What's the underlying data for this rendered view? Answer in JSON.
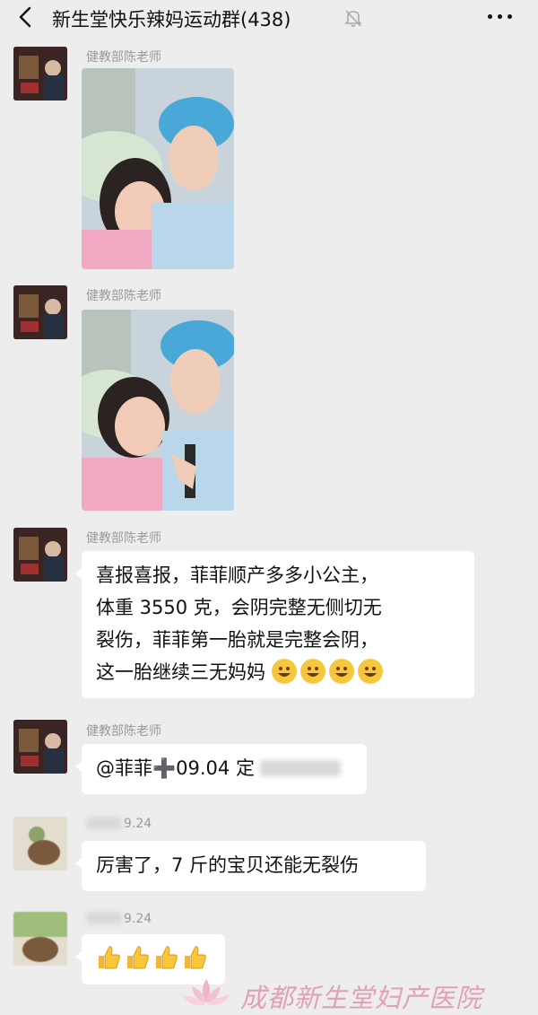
{
  "header": {
    "title": "新生堂快乐辣妈运动群(438)",
    "back_icon": "chevron-left-icon",
    "mute_icon": "bell-off-icon",
    "more_icon": "more-dots-icon"
  },
  "messages": [
    {
      "sender": "健教部陈老师",
      "type": "image"
    },
    {
      "sender": "健教部陈老师",
      "type": "image"
    },
    {
      "sender": "健教部陈老师",
      "type": "text",
      "lines": [
        "喜报喜报，菲菲顺产多多小公主，",
        "体重 3550 克，会阴完整无侧切无",
        "裂伤，菲菲第一胎就是完整会阴，",
        "这一胎继续三无妈妈"
      ],
      "emoji": "grinning-face-emoji",
      "emoji_count": 4
    },
    {
      "sender": "健教部陈老师",
      "type": "text",
      "lines": [
        "@菲菲➕09.04 定"
      ]
    },
    {
      "sender": "9.24",
      "type": "text",
      "lines": [
        "厉害了，7 斤的宝贝还能无裂伤"
      ]
    },
    {
      "sender": "9.24",
      "type": "text",
      "lines": [
        ""
      ],
      "emoji": "thumbs-up-emoji",
      "emoji_count": 4
    }
  ],
  "watermark": {
    "text": "成都新生堂妇产医院"
  },
  "colors": {
    "background": "#ededed",
    "bubble": "#ffffff",
    "sender_name": "#9a9a9a",
    "watermark": "#e1a0b8"
  }
}
